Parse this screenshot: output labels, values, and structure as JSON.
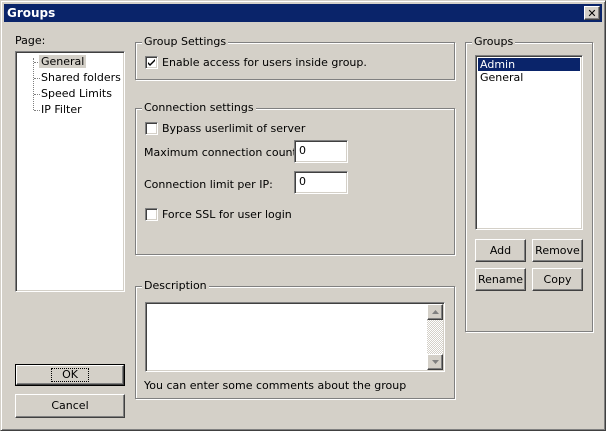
{
  "window": {
    "title": "Groups",
    "close_symbol": "✕"
  },
  "page_panel": {
    "label": "Page:",
    "items": [
      {
        "label": "General",
        "selected": true
      },
      {
        "label": "Shared folders"
      },
      {
        "label": "Speed Limits"
      },
      {
        "label": "IP Filter"
      }
    ]
  },
  "group_settings": {
    "legend": "Group Settings",
    "enable_access_label": "Enable access for users inside group.",
    "enable_access_checked": true
  },
  "connection_settings": {
    "legend": "Connection settings",
    "bypass_label": "Bypass userlimit of server",
    "bypass_checked": false,
    "max_count_label": "Maximum connection count:",
    "max_count_value": "0",
    "limit_per_ip_label": "Connection limit per IP:",
    "limit_per_ip_value": "0",
    "force_ssl_label": "Force SSL for user login",
    "force_ssl_checked": false
  },
  "description": {
    "legend": "Description",
    "value": "",
    "hint": "You can enter some comments about the group"
  },
  "groups_panel": {
    "legend": "Groups",
    "items": [
      {
        "label": "Admin",
        "selected": true
      },
      {
        "label": "General"
      }
    ],
    "add_label": "Add",
    "remove_label": "Remove",
    "rename_label": "Rename",
    "copy_label": "Copy"
  },
  "footer": {
    "ok_label": "OK",
    "cancel_label": "Cancel"
  }
}
